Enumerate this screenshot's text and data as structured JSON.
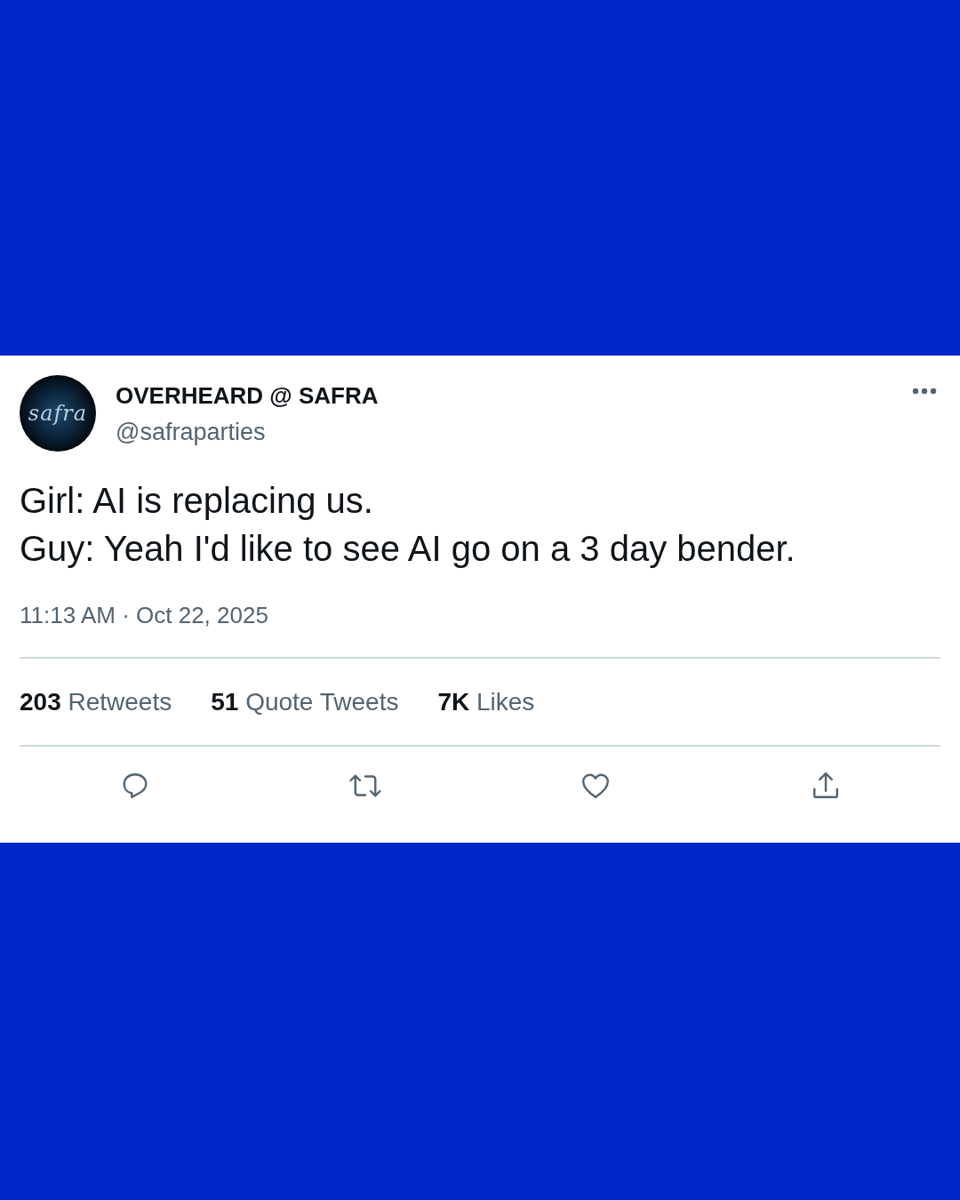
{
  "tweet": {
    "author": {
      "name": "OVERHEARD @ SAFRA",
      "handle": "@safraparties",
      "avatar": {
        "logo_text": "safra"
      }
    },
    "text_lines": [
      "Girl: AI is replacing us.",
      "Guy: Yeah I'd like to see AI go on a 3 day bender."
    ],
    "timestamp": "11:13 AM · Oct 22, 2025",
    "stats": [
      {
        "count": "203",
        "label": "Retweets"
      },
      {
        "count": "51",
        "label": "Quote Tweets"
      },
      {
        "count": "7K",
        "label": "Likes"
      }
    ]
  }
}
